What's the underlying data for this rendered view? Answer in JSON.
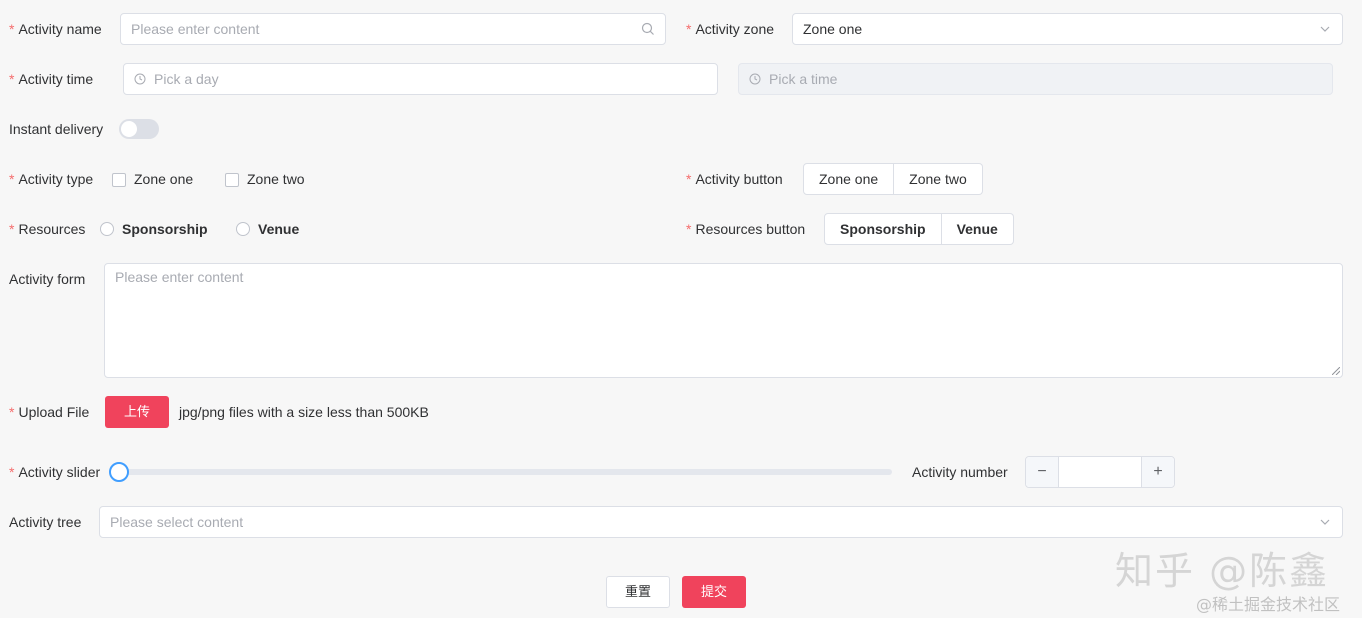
{
  "form": {
    "activity_name": {
      "label": "Activity name",
      "placeholder": "Please enter content",
      "icon": "search-icon"
    },
    "activity_zone": {
      "label": "Activity zone",
      "value": "Zone one",
      "icon": "chevron-down-icon"
    },
    "activity_time": {
      "label": "Activity time",
      "date_placeholder": "Pick a day",
      "time_placeholder": "Pick a time",
      "icon": "clock-icon"
    },
    "instant_delivery": {
      "label": "Instant delivery",
      "checked": false
    },
    "activity_type": {
      "label": "Activity type",
      "options": [
        "Zone one",
        "Zone two"
      ]
    },
    "activity_button": {
      "label": "Activity button",
      "options": [
        "Zone one",
        "Zone two"
      ]
    },
    "resources": {
      "label": "Resources",
      "options": [
        "Sponsorship",
        "Venue"
      ]
    },
    "resources_button": {
      "label": "Resources button",
      "options": [
        "Sponsorship",
        "Venue"
      ]
    },
    "activity_form": {
      "label": "Activity form",
      "placeholder": "Please enter content"
    },
    "upload": {
      "label": "Upload File",
      "button": "上传",
      "tip": "jpg/png files with a size less than 500KB"
    },
    "activity_slider": {
      "label": "Activity slider",
      "value": 0
    },
    "activity_number": {
      "label": "Activity number",
      "value": "",
      "minus": "−",
      "plus": "+"
    },
    "activity_tree": {
      "label": "Activity tree",
      "placeholder": "Please select content",
      "icon": "chevron-down-icon"
    },
    "required_mark": "*"
  },
  "actions": {
    "reset": "重置",
    "submit": "提交"
  },
  "watermark": {
    "main": "知乎 @陈鑫",
    "sub": "@稀土掘金技术社区"
  },
  "colors": {
    "primary": "#f0435c",
    "required": "#f56c6c",
    "slider_accent": "#409eff",
    "background": "#f7f7f7"
  }
}
